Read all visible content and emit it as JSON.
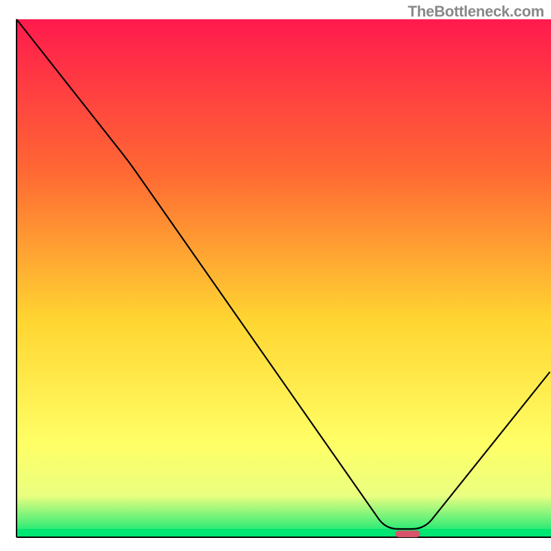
{
  "watermark": "TheBottleneck.com",
  "chart_data": {
    "type": "line",
    "title": "",
    "xlabel": "",
    "ylabel": "",
    "xlim": [
      0,
      100
    ],
    "ylim": [
      0,
      100
    ],
    "background_gradient": {
      "top_color": "#ff1a4d",
      "upper_mid_color": "#ff6a33",
      "mid_color": "#ffd531",
      "lower_mid_color": "#ffff66",
      "bottom_color": "#00e673"
    },
    "axis_color": "#000000",
    "border_left_x_frac": 0.03,
    "border_bottom_y_frac": 0.975,
    "border_top_y_frac": 0.035,
    "border_right_x_frac": 1.0,
    "curve_points": [
      {
        "x": 0.03,
        "y": 0.035
      },
      {
        "x": 0.235,
        "y": 0.295
      },
      {
        "x": 0.7,
        "y": 0.96
      },
      {
        "x": 0.77,
        "y": 0.96
      },
      {
        "x": 0.998,
        "y": 0.675
      }
    ],
    "marker": {
      "x_frac": 0.74,
      "y_frac": 0.969,
      "width_frac": 0.045,
      "height_frac": 0.012,
      "fill": "#d9536b",
      "rx": 5
    }
  }
}
